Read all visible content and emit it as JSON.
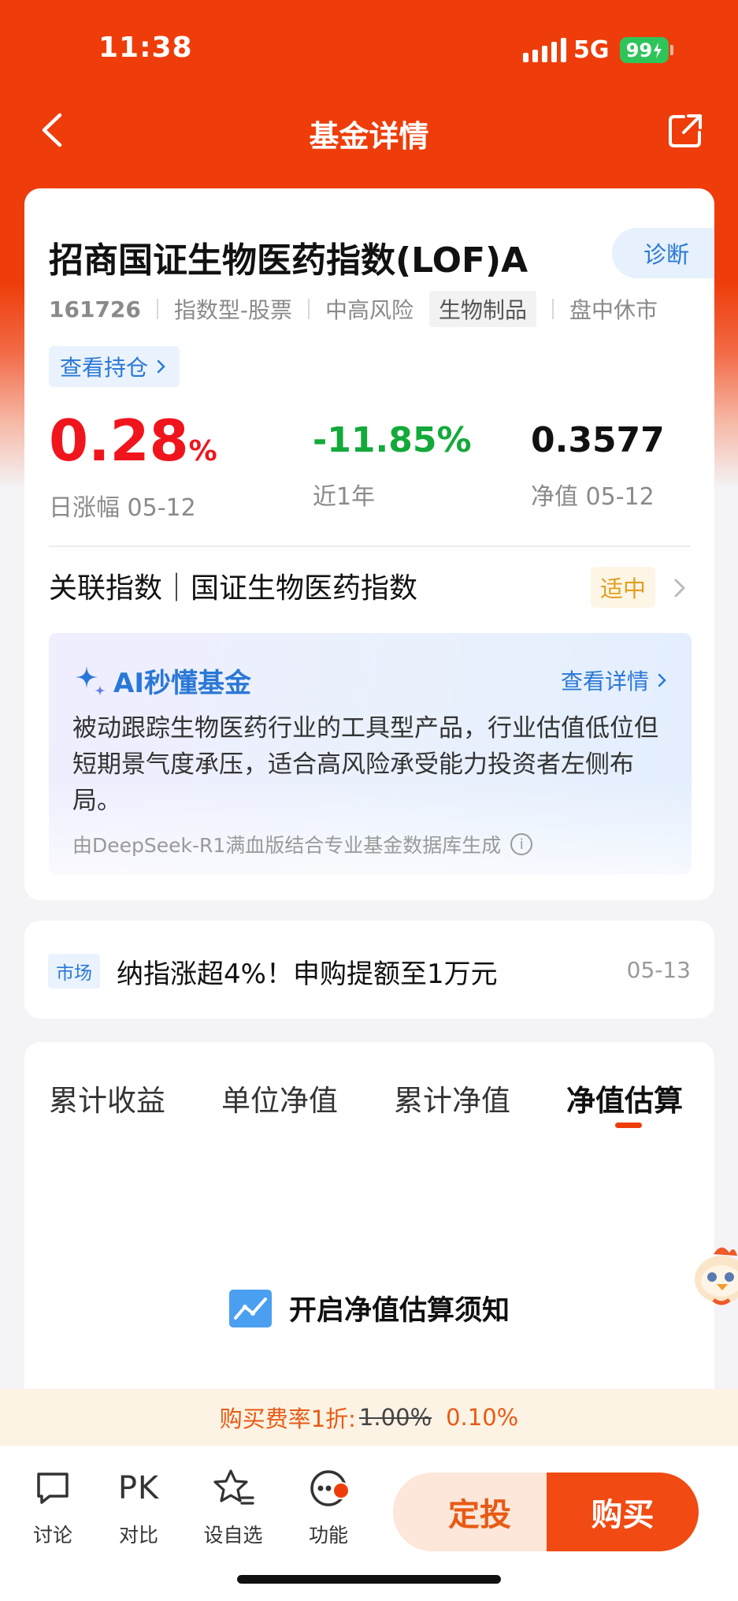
{
  "status": {
    "time": "11:38",
    "network": "5G",
    "battery": "99"
  },
  "nav": {
    "title": "基金详情"
  },
  "fund": {
    "name": "招商国证生物医药指数(LOF)A",
    "diagnose_label": "诊断",
    "code": "161726",
    "type": "指数型-股票",
    "risk": "中高风险",
    "sector_tag": "生物制品",
    "market_status": "盘中休市",
    "holdings_label": "查看持仓",
    "daily_change": {
      "value": "0.28",
      "unit": "%",
      "label": "日涨幅 05-12"
    },
    "year_return": {
      "value": "-11.85%",
      "label": "近1年"
    },
    "nav_value": {
      "value": "0.3577",
      "label": "净值 05-12"
    },
    "related_index": "关联指数｜国证生物医药指数",
    "valuation_tag": "适中"
  },
  "ai": {
    "title": "AI秒懂基金",
    "more_label": "查看详情",
    "summary": "被动跟踪生物医药行业的工具型产品，行业估值低位但短期景气度承压，适合高风险承受能力投资者左侧布局。",
    "source": "由DeepSeek-R1满血版结合专业基金数据库生成"
  },
  "news": {
    "tag": "市场",
    "text": "纳指涨超4%！申购提额至1万元",
    "date": "05-13"
  },
  "tabs": [
    {
      "label": "累计收益"
    },
    {
      "label": "单位净值"
    },
    {
      "label": "累计净值"
    },
    {
      "label": "净值估算"
    }
  ],
  "notice": {
    "title": "开启净值估算须知"
  },
  "fee": {
    "prefix": "购买费率1折:",
    "original": "1.00%",
    "current": "0.10%"
  },
  "bottom": {
    "discuss": "讨论",
    "pk_text": "PK",
    "compare": "对比",
    "watchlist": "设自选",
    "functions": "功能",
    "plan_button": "定投",
    "buy_button": "购买"
  },
  "colors": {
    "brand": "#ee3d0a",
    "up": "#f0151d",
    "down": "#14a93a",
    "link": "#2a78d6"
  }
}
